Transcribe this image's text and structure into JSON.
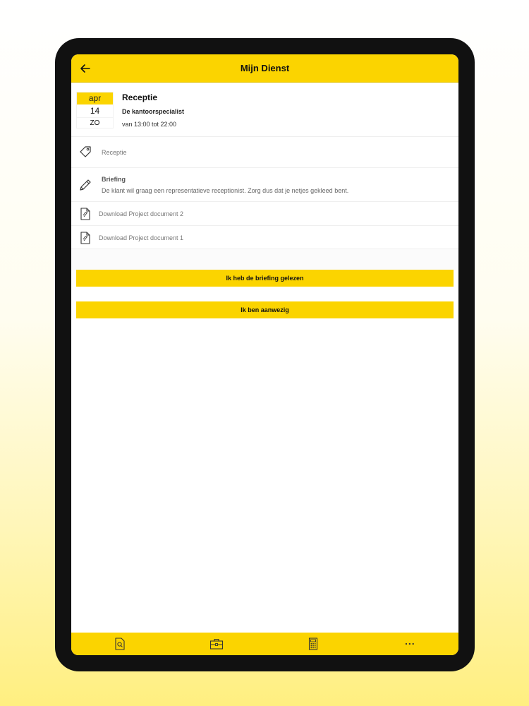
{
  "header": {
    "title": "Mijn Dienst"
  },
  "event": {
    "month": "apr",
    "day": "14",
    "weekday": "ZO",
    "title": "Receptie",
    "client": "De kantoorspecialist",
    "time": "van 13:00 tot 22:00"
  },
  "details": {
    "category": "Receptie",
    "briefing_label": "Briefing",
    "briefing_text": "De klant wil graag een representatieve receptionist. Zorg dus dat je netjes gekleed bent.",
    "documents": [
      "Download Project document 2",
      "Download Project document 1"
    ]
  },
  "actions": {
    "read_briefing": "Ik heb de briefing gelezen",
    "present": "Ik ben aanwezig"
  },
  "bottom_nav": {
    "items": [
      "search-icon",
      "briefcase-icon",
      "calculator-icon",
      "more-icon"
    ],
    "more_label": "..."
  },
  "colors": {
    "accent": "#fbd400",
    "frame": "#111111"
  }
}
